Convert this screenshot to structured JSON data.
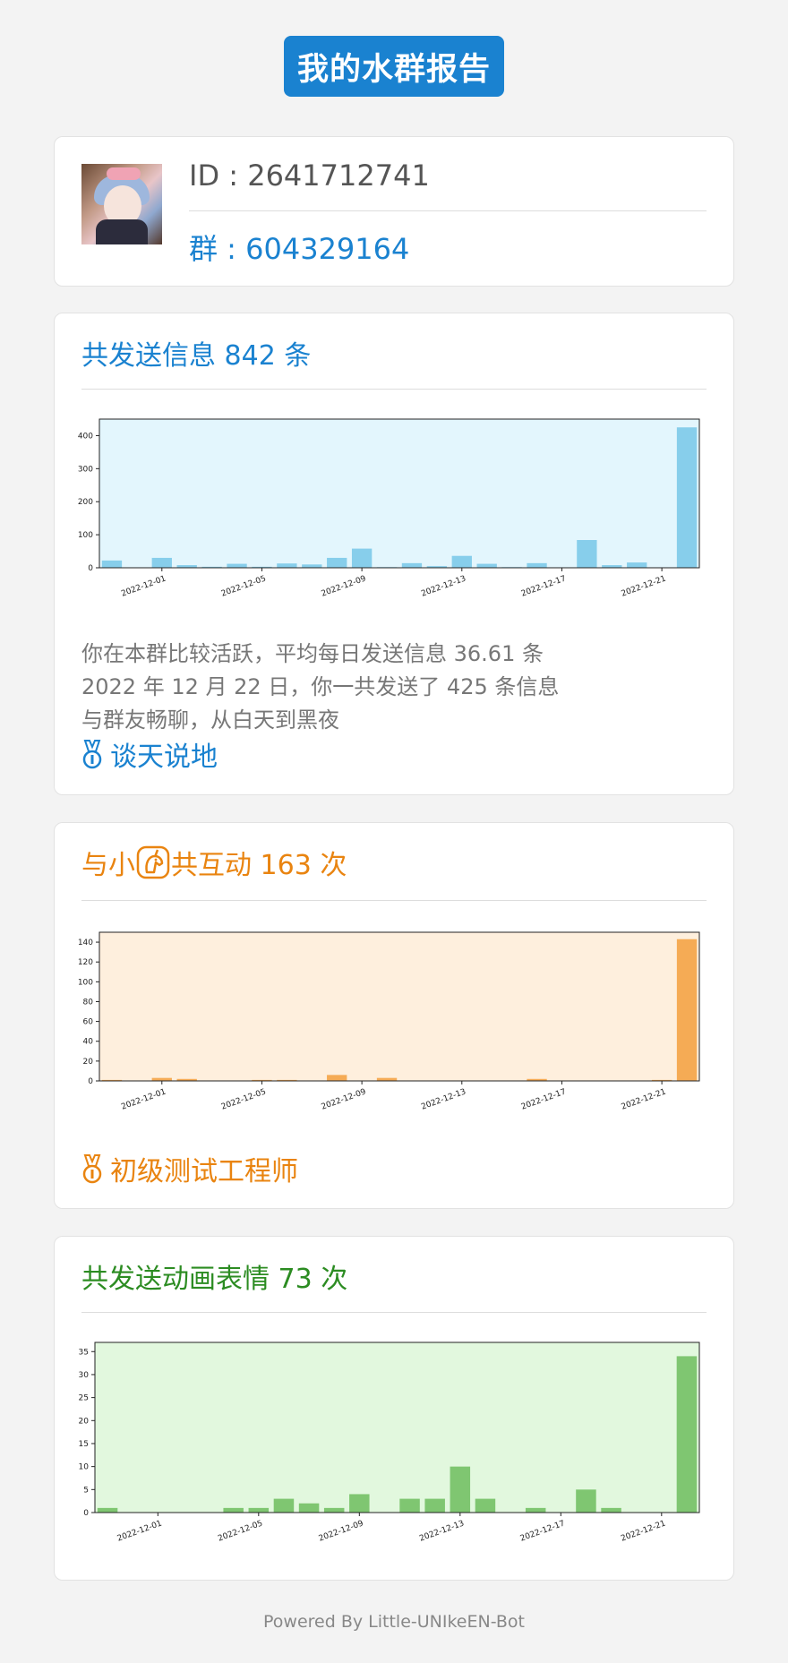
{
  "header": {
    "title": "我的水群报告"
  },
  "profile": {
    "id_text": "ID : 2641712741",
    "group_text": "群 : 604329164"
  },
  "messages": {
    "title": "共发送信息 842 条",
    "color": "#1a82d0",
    "lines": [
      "你在本群比较活跃，平均每日发送信息 36.61 条",
      "2022 年 12 月 22 日，你一共发送了 425 条信息",
      "与群友畅聊，从白天到黑夜"
    ],
    "badge": "谈天说地",
    "badge_icon": "medal-icon"
  },
  "interactions": {
    "title_prefix": "与小",
    "title_suffix": "共互动 163 次",
    "color": "#e98410",
    "icon": "unicorn-icon",
    "badge": "初级测试工程师",
    "badge_icon": "medal-icon"
  },
  "stickers": {
    "title": "共发送动画表情 73 次",
    "color": "#2c8c22"
  },
  "footer": {
    "text": "Powered By Little-UNIkeEN-Bot"
  },
  "chart_data": [
    {
      "type": "bar",
      "name": "messages",
      "x": [
        "2022-11-29",
        "2022-11-30",
        "2022-12-01",
        "2022-12-02",
        "2022-12-03",
        "2022-12-04",
        "2022-12-05",
        "2022-12-06",
        "2022-12-07",
        "2022-12-08",
        "2022-12-09",
        "2022-12-10",
        "2022-12-11",
        "2022-12-12",
        "2022-12-13",
        "2022-12-14",
        "2022-12-15",
        "2022-12-16",
        "2022-12-17",
        "2022-12-18",
        "2022-12-19",
        "2022-12-20",
        "2022-12-21",
        "2022-12-22"
      ],
      "values": [
        22,
        0,
        30,
        8,
        3,
        12,
        3,
        13,
        10,
        30,
        58,
        2,
        14,
        5,
        36,
        12,
        2,
        14,
        0,
        84,
        8,
        16,
        0,
        425
      ],
      "xticks": [
        "2022-12-01",
        "2022-12-05",
        "2022-12-09",
        "2022-12-13",
        "2022-12-17",
        "2022-12-21"
      ],
      "yticks": [
        0,
        100,
        200,
        300,
        400
      ],
      "ylim": [
        0,
        450
      ],
      "bar_color": "#87ceeb",
      "bg_color": "#e3f6fd"
    },
    {
      "type": "bar",
      "name": "interactions",
      "x": [
        "2022-11-29",
        "2022-11-30",
        "2022-12-01",
        "2022-12-02",
        "2022-12-03",
        "2022-12-04",
        "2022-12-05",
        "2022-12-06",
        "2022-12-07",
        "2022-12-08",
        "2022-12-09",
        "2022-12-10",
        "2022-12-11",
        "2022-12-12",
        "2022-12-13",
        "2022-12-14",
        "2022-12-15",
        "2022-12-16",
        "2022-12-17",
        "2022-12-18",
        "2022-12-19",
        "2022-12-20",
        "2022-12-21",
        "2022-12-22"
      ],
      "values": [
        1,
        0,
        3,
        2,
        0,
        0,
        1,
        1,
        0,
        6,
        0,
        3,
        0,
        0,
        0,
        0,
        0,
        2,
        0,
        0,
        0,
        0,
        1,
        143
      ],
      "xticks": [
        "2022-12-01",
        "2022-12-05",
        "2022-12-09",
        "2022-12-13",
        "2022-12-17",
        "2022-12-21"
      ],
      "yticks": [
        0,
        20,
        40,
        60,
        80,
        100,
        120,
        140
      ],
      "ylim": [
        0,
        150
      ],
      "bar_color": "#f5ab55",
      "bg_color": "#feefdd"
    },
    {
      "type": "bar",
      "name": "stickers",
      "x": [
        "2022-11-29",
        "2022-11-30",
        "2022-12-01",
        "2022-12-02",
        "2022-12-03",
        "2022-12-04",
        "2022-12-05",
        "2022-12-06",
        "2022-12-07",
        "2022-12-08",
        "2022-12-09",
        "2022-12-10",
        "2022-12-11",
        "2022-12-12",
        "2022-12-13",
        "2022-12-14",
        "2022-12-15",
        "2022-12-16",
        "2022-12-17",
        "2022-12-18",
        "2022-12-19",
        "2022-12-20",
        "2022-12-21",
        "2022-12-22"
      ],
      "values": [
        1,
        0,
        0,
        0,
        0,
        1,
        1,
        3,
        2,
        1,
        4,
        0,
        3,
        3,
        10,
        3,
        0,
        1,
        0,
        5,
        1,
        0,
        0,
        34
      ],
      "xticks": [
        "2022-12-01",
        "2022-12-05",
        "2022-12-09",
        "2022-12-13",
        "2022-12-17",
        "2022-12-21"
      ],
      "yticks": [
        0,
        5,
        10,
        15,
        20,
        25,
        30,
        35
      ],
      "ylim": [
        0,
        37
      ],
      "bar_color": "#7fc671",
      "bg_color": "#e2f8de"
    }
  ]
}
